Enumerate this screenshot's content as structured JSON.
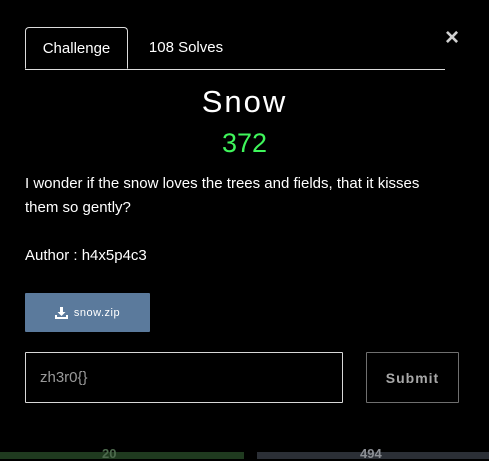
{
  "tabs": [
    {
      "label": "Challenge"
    },
    {
      "label": "108 Solves"
    }
  ],
  "close_glyph": "×",
  "challenge": {
    "name": "Snow",
    "value": "372",
    "description": "I wonder if the snow loves the trees and fields, that it kisses them so gently?",
    "author": "Author : h4x5p4c3"
  },
  "file": {
    "label": "snow.zip",
    "icon": "download-icon"
  },
  "flag": {
    "placeholder": "zh3r0{}",
    "value": ""
  },
  "submit_label": "Submit",
  "background_cards": [
    {
      "value": "20"
    },
    {
      "value": "494"
    }
  ],
  "colors": {
    "value_green": "#3ff65b",
    "file_button": "#5b7a9c",
    "background": "#000000"
  }
}
